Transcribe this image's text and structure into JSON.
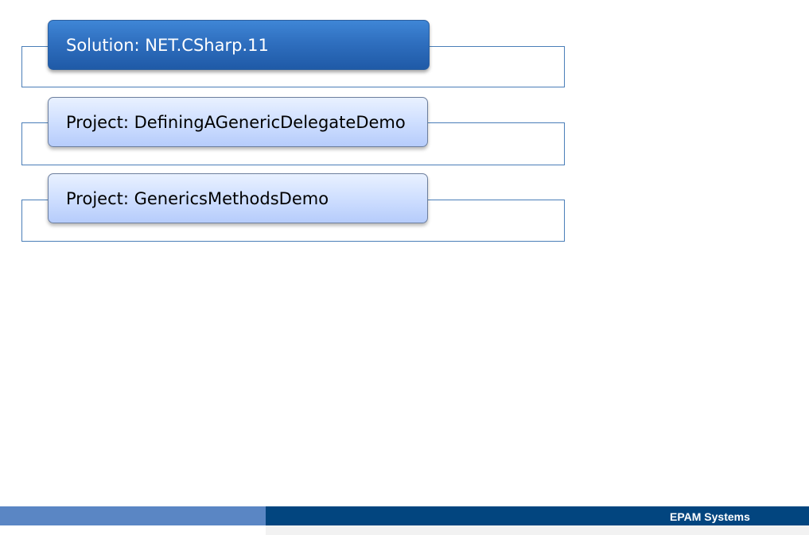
{
  "solution": {
    "label": "Solution: NET.CSharp.11"
  },
  "projects": [
    {
      "label": "Project: DefiningAGenericDelegateDemo"
    },
    {
      "label": "Project: GenericsMethodsDemo"
    }
  ],
  "footer": {
    "brand": "EPAM Systems"
  },
  "colors": {
    "solution_fill": "#2f6fbf",
    "project_fill": "#cfdfff",
    "frame_border": "#4a7eb8",
    "footer_dark": "#02457f",
    "footer_light": "#5a86c4"
  }
}
